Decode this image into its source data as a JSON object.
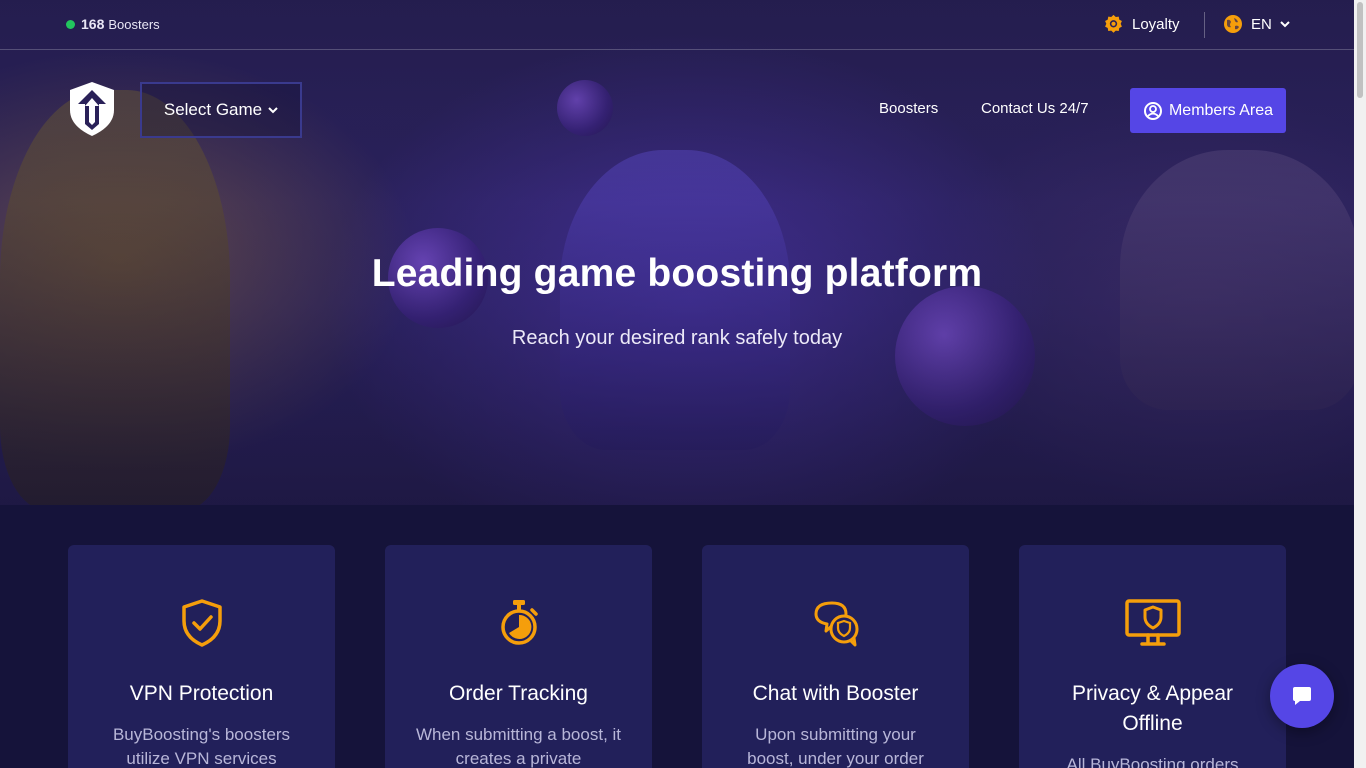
{
  "topbar": {
    "online_count": "168",
    "online_label": "Boosters",
    "loyalty_label": "Loyalty",
    "language": "EN"
  },
  "nav": {
    "select_game_label": "Select Game",
    "links": [
      "Boosters",
      "Contact Us 24/7"
    ],
    "members_label": "Members Area"
  },
  "hero": {
    "title": "Leading game boosting platform",
    "subtitle": "Reach your desired rank safely today"
  },
  "features": [
    {
      "title": "VPN Protection",
      "desc": "BuyBoosting's boosters utilize VPN services",
      "icon": "shield-check-icon"
    },
    {
      "title": "Order Tracking",
      "desc": "When submitting a boost, it creates a private",
      "icon": "stopwatch-icon"
    },
    {
      "title": "Chat with Booster",
      "desc": "Upon submitting your boost, under your order",
      "icon": "chat-bubbles-icon"
    },
    {
      "title": "Privacy & Appear Offline",
      "desc": "All BuyBoosting orders",
      "icon": "monitor-shield-icon"
    }
  ],
  "colors": {
    "accent": "#5546e6",
    "icon_orange": "#f59e0b",
    "online_green": "#22c55e",
    "card_bg": "#22205a",
    "page_bg": "#15133a"
  }
}
